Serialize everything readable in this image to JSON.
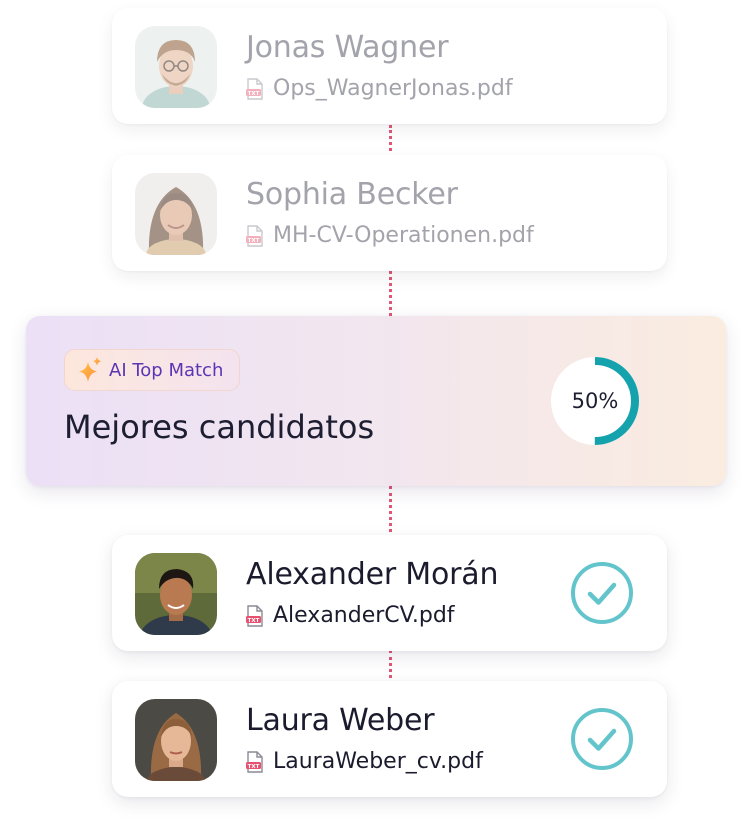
{
  "candidates_top": [
    {
      "name": "Jonas Wagner",
      "file": "Ops_WagnerJonas.pdf"
    },
    {
      "name": "Sophia Becker",
      "file": "MH-CV-Operationen.pdf"
    }
  ],
  "match": {
    "badge_label": "AI Top Match",
    "title": "Mejores candidatos",
    "percent_label": "50%",
    "percent_value": 0.5
  },
  "candidates_matched": [
    {
      "name": "Alexander Morán",
      "file": "AlexanderCV.pdf",
      "status": "selected"
    },
    {
      "name": "Laura Weber",
      "file": "LauraWeber_cv.pdf",
      "status": "selected"
    }
  ],
  "file_type_tag": "TXT",
  "icons": {
    "file": "file-icon",
    "check": "check-circle-icon",
    "sparkle": "sparkle-icon"
  },
  "colors": {
    "connector": "#e25577",
    "check": "#63c5cb",
    "progress": "#14a3ad",
    "badge_text": "#5a36b5",
    "file_icon": "#e8506f"
  }
}
